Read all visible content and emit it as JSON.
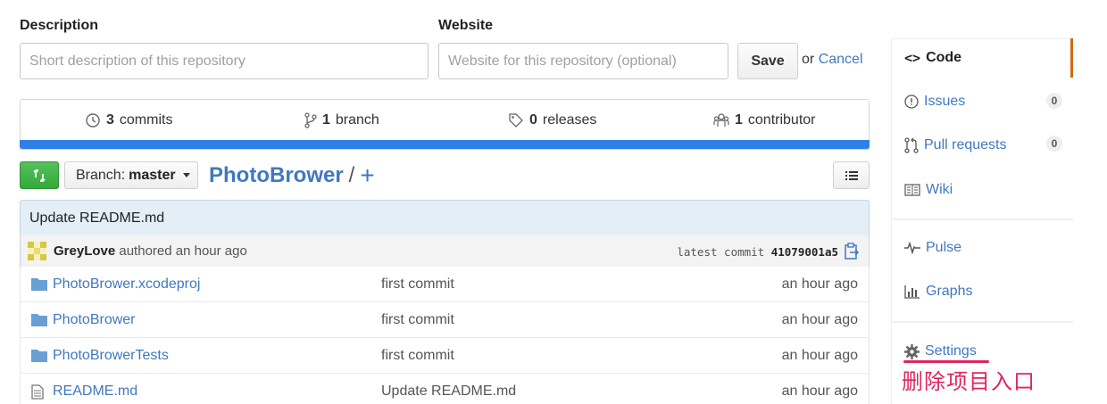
{
  "form": {
    "description_label": "Description",
    "description_placeholder": "Short description of this repository",
    "website_label": "Website",
    "website_placeholder": "Website for this repository (optional)",
    "save_label": "Save",
    "or_text": "or",
    "cancel_label": "Cancel"
  },
  "summary": {
    "commits_count": "3",
    "commits_label": "commits",
    "branch_count": "1",
    "branch_label": "branch",
    "releases_count": "0",
    "releases_label": "releases",
    "contributor_count": "1",
    "contributor_label": "contributor"
  },
  "toolbar": {
    "branch_prefix": "Branch:",
    "branch_name": "master",
    "repo_name": "PhotoBrower",
    "separator": "/",
    "add_symbol": "+"
  },
  "commit": {
    "message": "Update README.md",
    "author": "GreyLove",
    "authored_text": "authored an hour ago",
    "latest_label": "latest commit",
    "hash": "41079001a5"
  },
  "files": [
    {
      "name": "PhotoBrower.xcodeproj",
      "message": "first commit",
      "age": "an hour ago",
      "icon": "folder-icon"
    },
    {
      "name": "PhotoBrower",
      "message": "first commit",
      "age": "an hour ago",
      "icon": "folder-icon"
    },
    {
      "name": "PhotoBrowerTests",
      "message": "first commit",
      "age": "an hour ago",
      "icon": "folder-icon"
    },
    {
      "name": "README.md",
      "message": "Update README.md",
      "age": "an hour ago",
      "icon": "file-icon"
    }
  ],
  "sidebar": {
    "code": "Code",
    "issues": "Issues",
    "issues_count": "0",
    "pull_requests": "Pull requests",
    "pull_requests_count": "0",
    "wiki": "Wiki",
    "pulse": "Pulse",
    "graphs": "Graphs",
    "settings": "Settings"
  },
  "annotation": "删除项目入口",
  "colors": {
    "link": "#4078c0",
    "accent_bar": "#2f7fe8",
    "selected_tab": "#d26911",
    "annotation": "#e0245e",
    "pr_button": "#3fb34a"
  }
}
